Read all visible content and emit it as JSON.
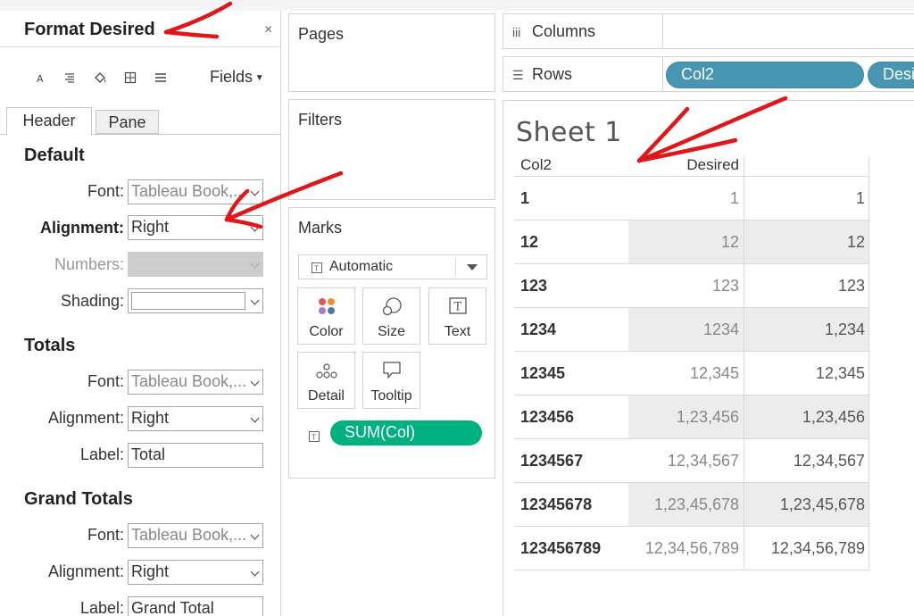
{
  "format_pane": {
    "title": "Format Desired",
    "close": "×",
    "fields_label": "Fields",
    "tabs": [
      "Header",
      "Pane"
    ],
    "default": {
      "heading": "Default",
      "font_label": "Font:",
      "font_value": "Tableau Book,...",
      "alignment_label": "Alignment:",
      "alignment_value": "Right",
      "numbers_label": "Numbers:",
      "shading_label": "Shading:"
    },
    "totals": {
      "heading": "Totals",
      "font_label": "Font:",
      "font_value": "Tableau Book,...",
      "alignment_label": "Alignment:",
      "alignment_value": "Right",
      "label_label": "Label:",
      "label_value": "Total"
    },
    "grand_totals": {
      "heading": "Grand Totals",
      "font_label": "Font:",
      "font_value": "Tableau Book,...",
      "alignment_label": "Alignment:",
      "alignment_value": "Right",
      "label_label": "Label:",
      "label_value": "Grand Total"
    }
  },
  "cards": {
    "pages": "Pages",
    "filters": "Filters",
    "marks": {
      "title": "Marks",
      "mark_type": "Automatic",
      "buttons": [
        "Color",
        "Size",
        "Text",
        "Detail",
        "Tooltip"
      ],
      "text_pill": "SUM(Col)"
    }
  },
  "shelves": {
    "columns": "Columns",
    "rows": "Rows",
    "row_pills": [
      "Col2",
      "Desi"
    ]
  },
  "sheet": {
    "title": "Sheet 1",
    "headers": [
      "Col2",
      "Desired",
      ""
    ],
    "rows": [
      [
        "1",
        "1",
        "1"
      ],
      [
        "12",
        "12",
        "12"
      ],
      [
        "123",
        "123",
        "123"
      ],
      [
        "1234",
        "1234",
        "1,234"
      ],
      [
        "12345",
        "12,345",
        "12,345"
      ],
      [
        "123456",
        "1,23,456",
        "1,23,456"
      ],
      [
        "1234567",
        "12,34,567",
        "12,34,567"
      ],
      [
        "12345678",
        "1,23,45,678",
        "1,23,45,678"
      ],
      [
        "123456789",
        "12,34,56,789",
        "12,34,56,789"
      ]
    ]
  },
  "colors": {
    "dimension_pill": "#4996b2",
    "measure_pill": "#00b180",
    "annotation": "#e0161b"
  }
}
